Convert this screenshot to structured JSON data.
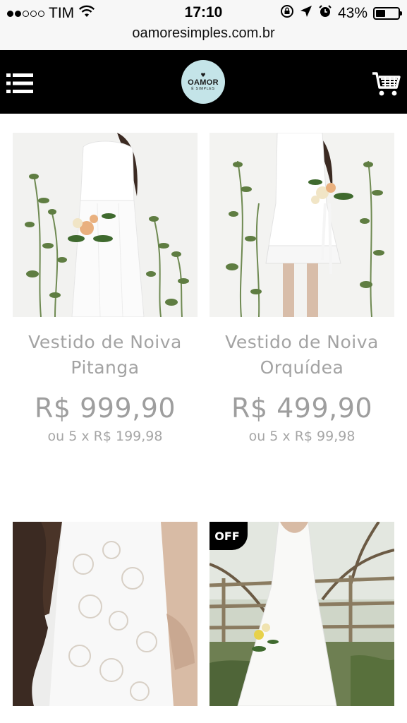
{
  "status_bar": {
    "carrier": "TIM",
    "time": "17:10",
    "battery_percent_label": "43%",
    "battery_level": 0.43,
    "signal_bars_filled": 2,
    "signal_bars_total": 5,
    "icons": [
      "wifi-icon",
      "orientation-lock-icon",
      "location-arrow-icon",
      "alarm-icon",
      "battery-icon"
    ]
  },
  "browser": {
    "url": "oamoresimples.com.br"
  },
  "header": {
    "logo_main": "OAMOR",
    "logo_sub": "É SIMPLES",
    "icons": [
      "menu-icon",
      "cart-icon"
    ],
    "background": "#000000",
    "logo_color": "#c4e4e8"
  },
  "products": [
    {
      "name_line1": "Vestido de Noiva",
      "name_line2": "Pitanga",
      "price": "R$ 999,90",
      "installment": "ou 5 x R$ 199,98"
    },
    {
      "name_line1": "Vestido de Noiva",
      "name_line2": "Orquídea",
      "price": "R$ 499,90",
      "installment": "ou 5 x R$ 99,98"
    },
    {},
    {
      "badge": "OFF"
    }
  ]
}
